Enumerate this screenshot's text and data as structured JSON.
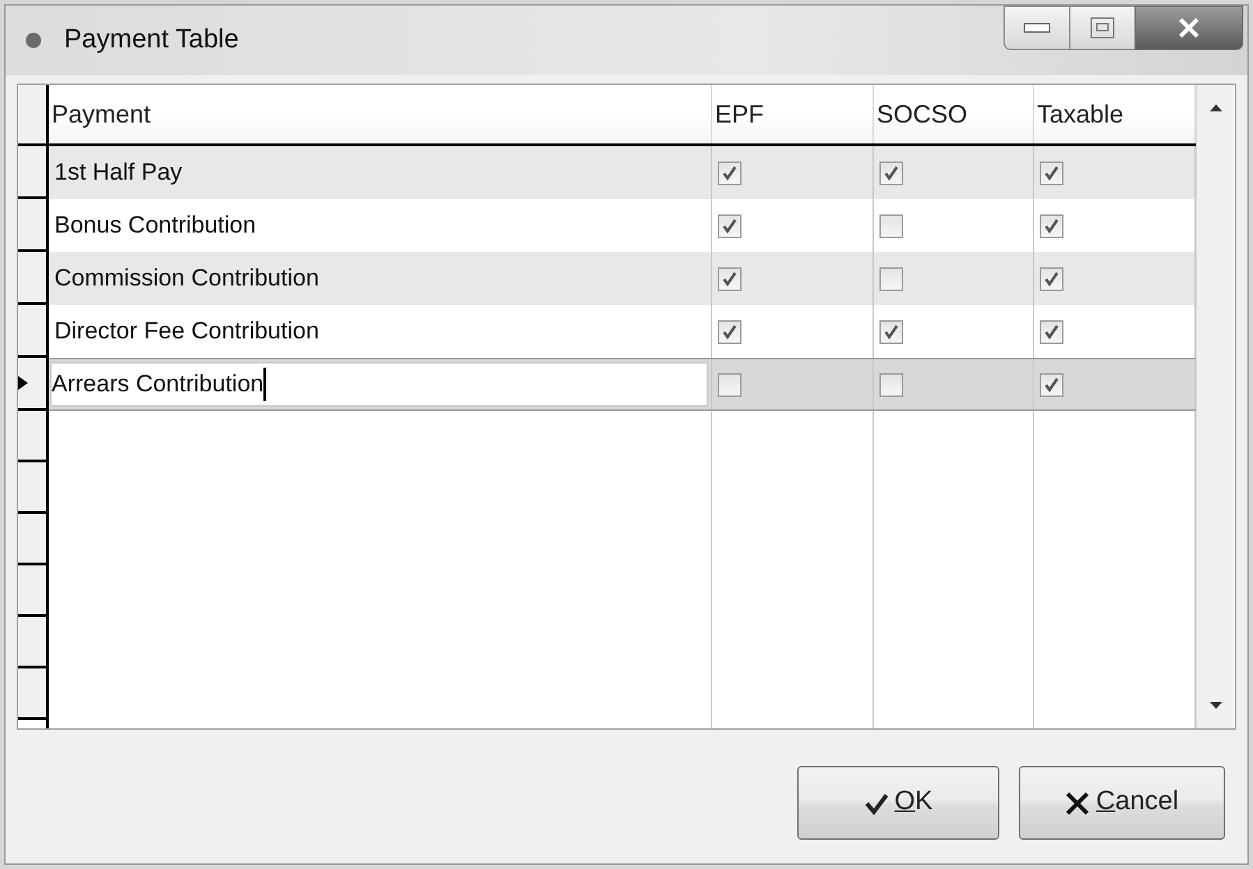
{
  "window": {
    "title": "Payment Table"
  },
  "table": {
    "columns": [
      "Payment",
      "EPF",
      "SOCSO",
      "Taxable"
    ],
    "rows": [
      {
        "payment": "1st Half Pay",
        "epf": true,
        "socso": true,
        "taxable": true,
        "selected": false
      },
      {
        "payment": "Bonus Contribution",
        "epf": true,
        "socso": false,
        "taxable": true,
        "selected": false
      },
      {
        "payment": "Commission Contribution",
        "epf": true,
        "socso": false,
        "taxable": true,
        "selected": false
      },
      {
        "payment": "Director Fee Contribution",
        "epf": true,
        "socso": true,
        "taxable": true,
        "selected": false
      },
      {
        "payment": "Arrears Contribution",
        "epf": false,
        "socso": false,
        "taxable": true,
        "selected": true
      }
    ]
  },
  "buttons": [
    {
      "label": "OK",
      "kind": "ok"
    },
    {
      "label": "Cancel",
      "kind": "cancel"
    }
  ]
}
